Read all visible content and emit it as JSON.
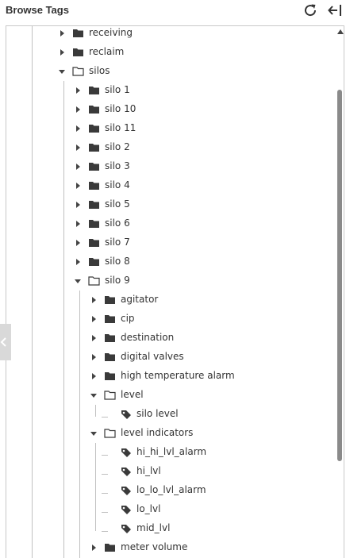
{
  "header": {
    "title": "Browse Tags",
    "refresh_icon": "refresh-icon",
    "collapse_icon": "collapse-panel-icon"
  },
  "tree": {
    "items": [
      {
        "label": "receiving",
        "type": "folder",
        "state": "collapsed",
        "depth": 1
      },
      {
        "label": "reclaim",
        "type": "folder",
        "state": "collapsed",
        "depth": 1
      },
      {
        "label": "silos",
        "type": "folder",
        "state": "expanded",
        "depth": 1
      },
      {
        "label": "silo 1",
        "type": "folder",
        "state": "collapsed",
        "depth": 2
      },
      {
        "label": "silo 10",
        "type": "folder",
        "state": "collapsed",
        "depth": 2
      },
      {
        "label": "silo 11",
        "type": "folder",
        "state": "collapsed",
        "depth": 2
      },
      {
        "label": "silo 2",
        "type": "folder",
        "state": "collapsed",
        "depth": 2
      },
      {
        "label": "silo 3",
        "type": "folder",
        "state": "collapsed",
        "depth": 2
      },
      {
        "label": "silo 4",
        "type": "folder",
        "state": "collapsed",
        "depth": 2
      },
      {
        "label": "silo 5",
        "type": "folder",
        "state": "collapsed",
        "depth": 2
      },
      {
        "label": "silo 6",
        "type": "folder",
        "state": "collapsed",
        "depth": 2
      },
      {
        "label": "silo 7",
        "type": "folder",
        "state": "collapsed",
        "depth": 2
      },
      {
        "label": "silo 8",
        "type": "folder",
        "state": "collapsed",
        "depth": 2
      },
      {
        "label": "silo 9",
        "type": "folder",
        "state": "expanded",
        "depth": 2
      },
      {
        "label": "agitator",
        "type": "folder",
        "state": "collapsed",
        "depth": 3
      },
      {
        "label": "cip",
        "type": "folder",
        "state": "collapsed",
        "depth": 3
      },
      {
        "label": "destination",
        "type": "folder",
        "state": "collapsed",
        "depth": 3
      },
      {
        "label": "digital valves",
        "type": "folder",
        "state": "collapsed",
        "depth": 3
      },
      {
        "label": "high temperature alarm",
        "type": "folder",
        "state": "collapsed",
        "depth": 3
      },
      {
        "label": "level",
        "type": "folder",
        "state": "expanded",
        "depth": 3
      },
      {
        "label": "silo level",
        "type": "tag",
        "state": "leaf",
        "depth": 4
      },
      {
        "label": "level indicators",
        "type": "folder",
        "state": "expanded",
        "depth": 3
      },
      {
        "label": "hi_hi_lvl_alarm",
        "type": "tag",
        "state": "leaf",
        "depth": 4
      },
      {
        "label": "hi_lvl",
        "type": "tag",
        "state": "leaf",
        "depth": 4
      },
      {
        "label": "lo_lo_lvl_alarm",
        "type": "tag",
        "state": "leaf",
        "depth": 4
      },
      {
        "label": "lo_lvl",
        "type": "tag",
        "state": "leaf",
        "depth": 4
      },
      {
        "label": "mid_lvl",
        "type": "tag",
        "state": "leaf",
        "depth": 4
      },
      {
        "label": "meter volume",
        "type": "folder",
        "state": "collapsed",
        "depth": 3
      }
    ]
  },
  "colors": {
    "icon": "#3a3a3a",
    "guide": "#c0c0c0",
    "scroll_thumb": "#8a8a8a",
    "side_tab": "#d9d9d9"
  },
  "sidetab": {
    "icon": "chevron-left-icon"
  }
}
